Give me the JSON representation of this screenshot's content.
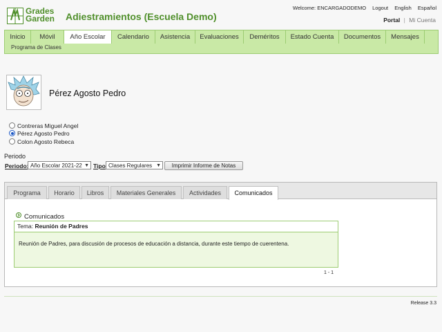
{
  "logo": {
    "line1": "Grades",
    "line2": "Garden"
  },
  "header": {
    "title": "Adiestramientos (Escuela Demo)",
    "welcome": "Welcome: ENCARGADODEMO",
    "logout": "Logout",
    "english": "English",
    "espanol": "Español",
    "portal": "Portal",
    "separator": "|",
    "mi_cuenta": "Mi Cuenta"
  },
  "nav": {
    "items": [
      "Inicio",
      "Móvil",
      "Año Escolar",
      "Calendario",
      "Asistencia",
      "Evaluaciones",
      "Deméritos",
      "Estado Cuenta",
      "Documentos",
      "Mensajes"
    ],
    "active_index": 2,
    "sub_item": "Programa de Clases"
  },
  "student": {
    "name": "Pérez Agosto Pedro",
    "options": [
      "Contreras Miguel Angel",
      "Pérez Agosto Pedro",
      "Colon Agosto Rebeca"
    ],
    "selected_index": 1
  },
  "filters": {
    "heading": "Periodo",
    "periodo_label": "Periodo:",
    "periodo_value": "Año Escolar 2021-22",
    "tipo_label": "Tipo",
    "tipo_value": "Clases Regulares",
    "print_button": "Imprimir Informe de Notas"
  },
  "tabs": {
    "items": [
      "Programa",
      "Horario",
      "Libros",
      "Materiales Generales",
      "Actividades",
      "Comunicados"
    ],
    "active_index": 5
  },
  "comunicados": {
    "section_title": "Comunicados",
    "tema_label": "Tema:",
    "tema_value": "Reunión de Padres",
    "body": "Reunión de Padres, para discusión de procesos de educación a distancia, durante este tiempo de cuerentena.",
    "pager": "1 - 1"
  },
  "footer": {
    "release": "Release 3.3"
  },
  "colors": {
    "accent": "#4f8f2a",
    "nav_bg": "#c9e9a6",
    "panel_bg": "#eef8e1"
  }
}
